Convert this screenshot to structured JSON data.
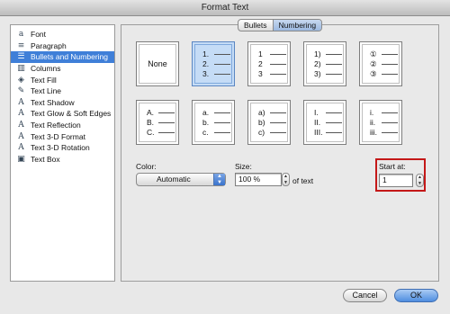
{
  "window": {
    "title": "Format Text"
  },
  "sidebar": {
    "items": [
      {
        "label": "Font",
        "icon": "font-icon",
        "glyph": "a"
      },
      {
        "label": "Paragraph",
        "icon": "paragraph-icon",
        "glyph": "≡"
      },
      {
        "label": "Bullets and Numbering",
        "icon": "bullets-icon",
        "glyph": "☰",
        "selected": true
      },
      {
        "label": "Columns",
        "icon": "columns-icon",
        "glyph": "▥"
      },
      {
        "label": "Text Fill",
        "icon": "paint-bucket-icon",
        "glyph": "◈"
      },
      {
        "label": "Text Line",
        "icon": "pen-icon",
        "glyph": "✎"
      },
      {
        "label": "Text Shadow",
        "icon": "text-shadow-icon",
        "glyph": "A"
      },
      {
        "label": "Text Glow & Soft Edges",
        "icon": "text-glow-icon",
        "glyph": "A"
      },
      {
        "label": "Text Reflection",
        "icon": "text-reflection-icon",
        "glyph": "A"
      },
      {
        "label": "Text 3-D Format",
        "icon": "text-3d-format-icon",
        "glyph": "A"
      },
      {
        "label": "Text 3-D Rotation",
        "icon": "text-3d-rotation-icon",
        "glyph": "A"
      },
      {
        "label": "Text Box",
        "icon": "text-box-icon",
        "glyph": "▣"
      }
    ]
  },
  "tabs": {
    "bullets": "Bullets",
    "numbering": "Numbering",
    "active": "Numbering"
  },
  "numbering_styles": {
    "none_label": "None",
    "row1": [
      {
        "markers": [
          "1.",
          "2.",
          "3."
        ]
      },
      {
        "markers": [
          "1",
          "2",
          "3"
        ]
      },
      {
        "markers": [
          "1)",
          "2)",
          "3)"
        ]
      },
      {
        "markers": [
          "①",
          "②",
          "③"
        ]
      }
    ],
    "row2": [
      {
        "markers": [
          "A.",
          "B.",
          "C."
        ]
      },
      {
        "markers": [
          "a.",
          "b.",
          "c."
        ]
      },
      {
        "markers": [
          "a)",
          "b)",
          "c)"
        ]
      },
      {
        "markers": [
          "I.",
          "II.",
          "III."
        ]
      },
      {
        "markers": [
          "i.",
          "ii.",
          "iii."
        ]
      }
    ]
  },
  "color": {
    "label": "Color:",
    "value": "Automatic"
  },
  "size": {
    "label": "Size:",
    "value": "100 %",
    "suffix": "of text"
  },
  "start_at": {
    "label": "Start at:",
    "value": "1"
  },
  "buttons": {
    "cancel": "Cancel",
    "ok": "OK"
  },
  "colors": {
    "selection": "#3f7fd8",
    "highlight": "#c41818",
    "default_button": "#4f8ee0"
  }
}
